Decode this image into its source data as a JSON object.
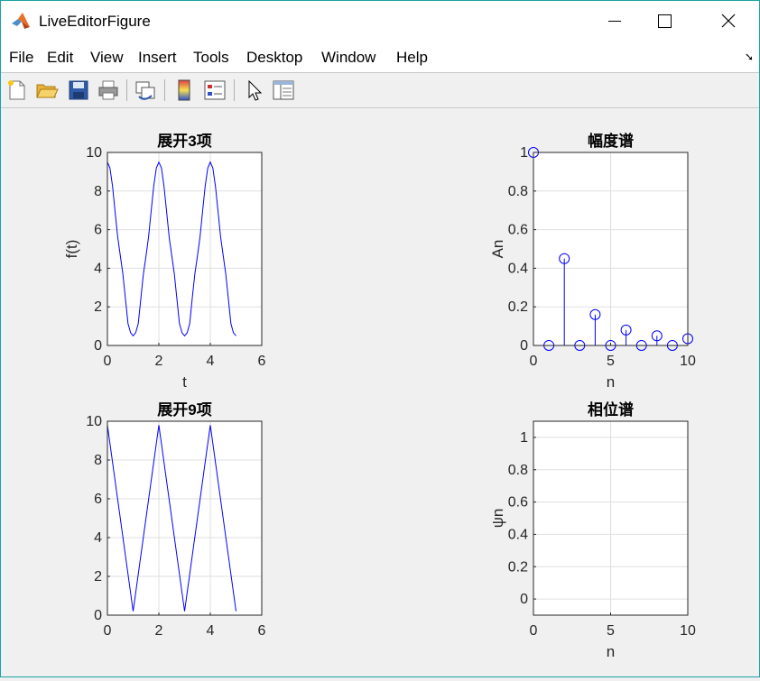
{
  "window": {
    "title": "LiveEditorFigure"
  },
  "menu": [
    "File",
    "Edit",
    "View",
    "Insert",
    "Tools",
    "Desktop",
    "Window",
    "Help"
  ],
  "toolbar": [
    "new-figure",
    "open-file",
    "save",
    "print",
    "link-plot",
    "insert-colorbar",
    "insert-legend",
    "edit-plot",
    "property-inspector"
  ],
  "colors": {
    "line": "#0000ff",
    "axis": "#262626",
    "grid": "#dfdfdf",
    "title_accent": "#0078d7"
  },
  "chart_data": [
    {
      "type": "line",
      "title": "展开3项",
      "xlabel": "t",
      "ylabel": "f(t)",
      "xlim": [
        0,
        6
      ],
      "ylim": [
        0,
        10
      ],
      "xticks": [
        "0",
        "2",
        "4",
        "6"
      ],
      "yticks": [
        "0",
        "2",
        "4",
        "6",
        "8",
        "10"
      ],
      "grid": true,
      "series": [
        {
          "x": [
            0,
            0.1,
            0.2,
            0.3,
            0.4,
            0.5,
            0.6,
            0.7,
            0.8,
            0.9,
            1.0,
            1.1,
            1.2,
            1.3,
            1.4,
            1.5,
            1.6,
            1.7,
            1.8,
            1.9,
            2.0,
            2.1,
            2.2,
            2.3,
            2.4,
            2.5,
            2.6,
            2.7,
            2.8,
            2.9,
            3.0,
            3.1,
            3.2,
            3.3,
            3.4,
            3.5,
            3.6,
            3.7,
            3.8,
            3.9,
            4.0,
            4.1,
            4.2,
            4.3,
            4.4,
            4.5,
            4.6,
            4.7,
            4.8,
            4.9,
            5.0
          ],
          "y": [
            9.5,
            9.19,
            8.25,
            6.93,
            5.62,
            4.65,
            3.72,
            2.46,
            1.14,
            0.66,
            0.5,
            0.66,
            1.14,
            2.46,
            3.72,
            4.65,
            5.62,
            6.93,
            8.25,
            9.19,
            9.5,
            9.19,
            8.25,
            6.93,
            5.62,
            4.65,
            3.72,
            2.46,
            1.14,
            0.66,
            0.5,
            0.66,
            1.14,
            2.46,
            3.72,
            4.65,
            5.62,
            6.93,
            8.25,
            9.19,
            9.5,
            9.19,
            8.25,
            6.93,
            5.62,
            4.65,
            3.72,
            2.46,
            1.14,
            0.66,
            0.5
          ]
        }
      ]
    },
    {
      "type": "stem",
      "title": "幅度谱",
      "xlabel": "n",
      "ylabel": "An",
      "xlim": [
        0,
        10
      ],
      "ylim": [
        0,
        1
      ],
      "xticks": [
        "0",
        "5",
        "10"
      ],
      "yticks": [
        "0",
        "0.2",
        "0.4",
        "0.6",
        "0.8",
        "1"
      ],
      "grid": true,
      "series": [
        {
          "x": [
            0,
            1,
            2,
            3,
            4,
            5,
            6,
            7,
            8,
            9,
            10
          ],
          "y": [
            1.0,
            0,
            0.45,
            0,
            0.16,
            0,
            0.08,
            0,
            0.05,
            0,
            0.035
          ]
        }
      ]
    },
    {
      "type": "line",
      "title": "展开9项",
      "xlabel": "",
      "ylabel": "",
      "xlim": [
        0,
        6
      ],
      "ylim": [
        0,
        10
      ],
      "xticks": [
        "0",
        "2",
        "4",
        "6"
      ],
      "yticks": [
        "0",
        "2",
        "4",
        "6",
        "8",
        "10"
      ],
      "grid": true,
      "series": [
        {
          "x": [
            0,
            1,
            2,
            3,
            4,
            5
          ],
          "y": [
            9.8,
            0.2,
            9.8,
            0.2,
            9.8,
            0.2
          ]
        }
      ]
    },
    {
      "type": "stem",
      "title": "相位谱",
      "xlabel": "n",
      "ylabel": "ψn",
      "xlim": [
        0,
        10
      ],
      "ylim": [
        -0.1,
        1.1
      ],
      "xticks": [
        "0",
        "5",
        "10"
      ],
      "yticks": [
        "0",
        "0.2",
        "0.4",
        "0.6",
        "0.8",
        "1"
      ],
      "grid": true,
      "series": []
    }
  ]
}
